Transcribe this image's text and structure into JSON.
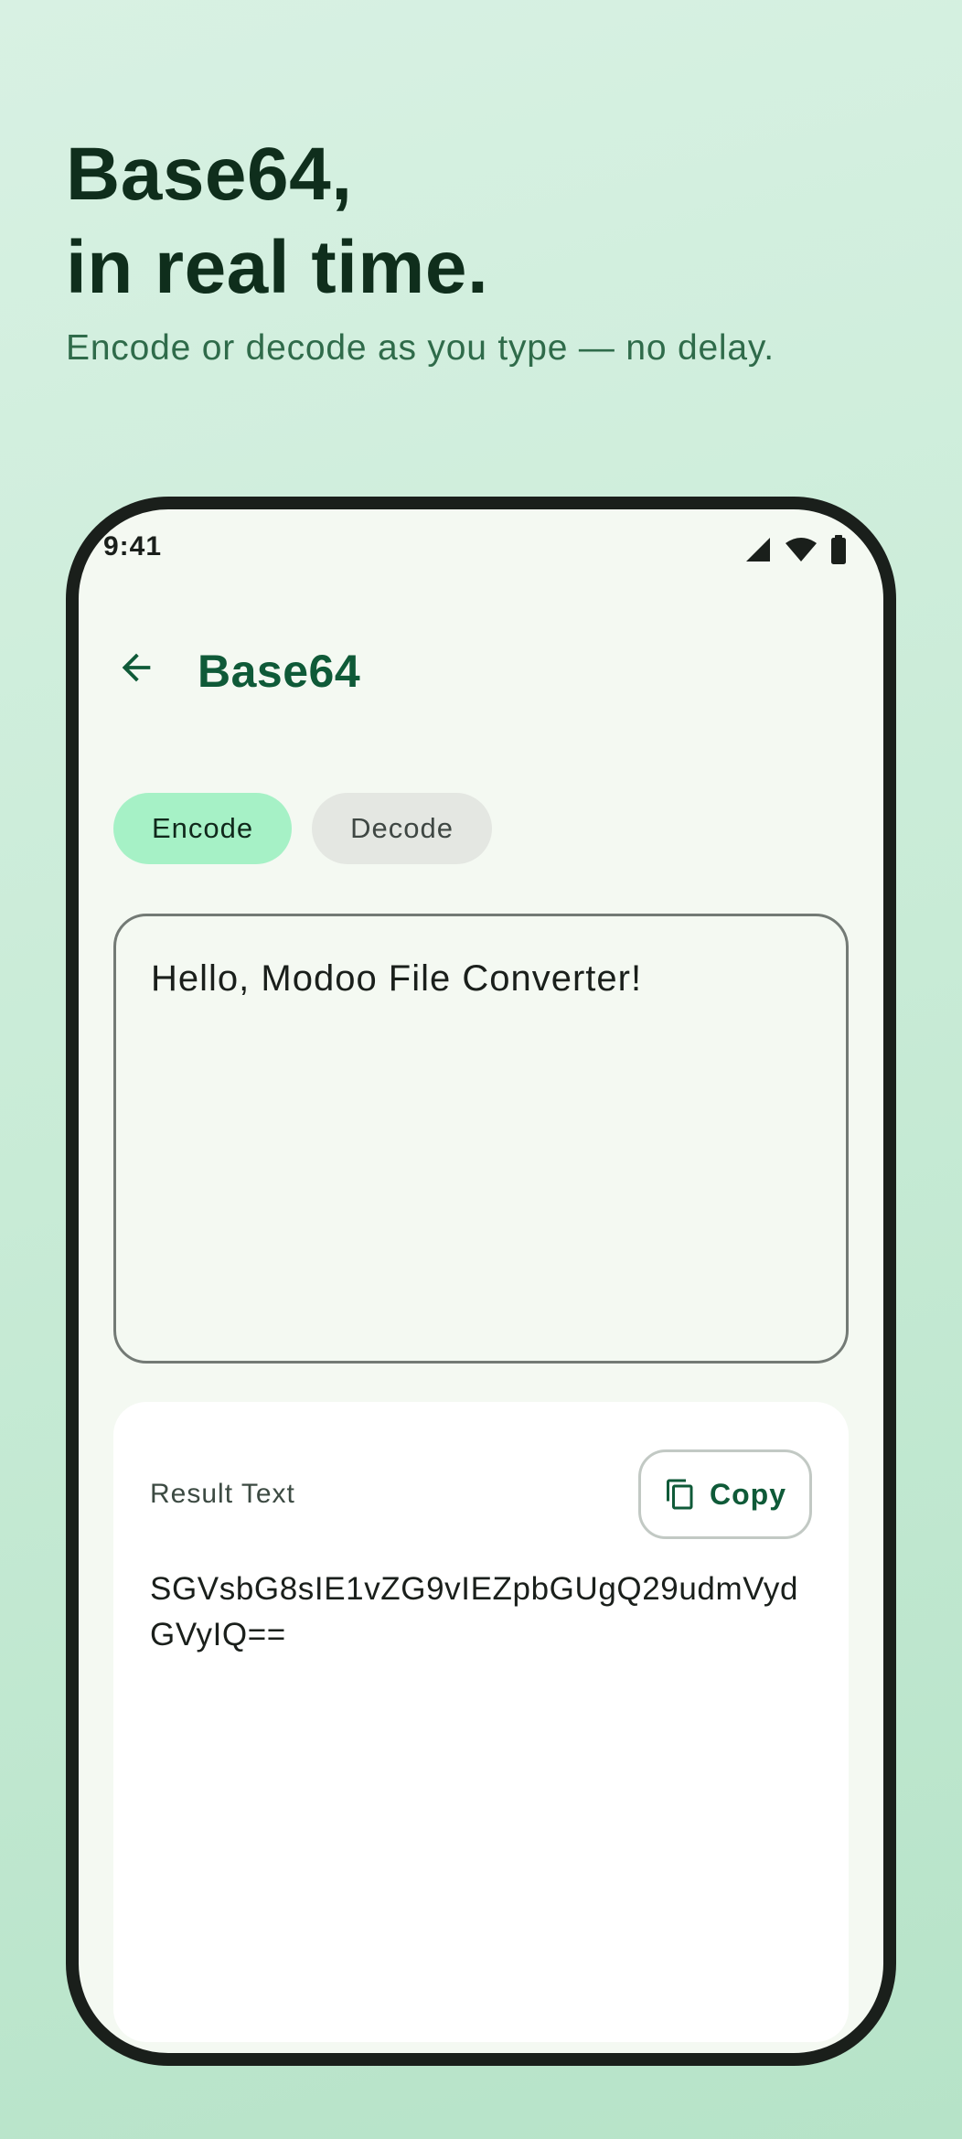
{
  "hero": {
    "title_line1": "Base64,",
    "title_line2": "in real time.",
    "subtitle": "Encode or decode as you type — no delay."
  },
  "status_bar": {
    "time": "9:41",
    "icons": [
      "signal-icon",
      "wifi-icon",
      "battery-icon"
    ]
  },
  "app_bar": {
    "back_icon": "arrow-back-icon",
    "title": "Base64"
  },
  "mode_chips": [
    {
      "label": "Encode",
      "selected": true
    },
    {
      "label": "Decode",
      "selected": false
    }
  ],
  "input": {
    "value": "Hello, Modoo File Converter!"
  },
  "result": {
    "label": "Result Text",
    "copy_label": "Copy",
    "copy_icon": "copy-icon",
    "text": "SGVsbG8sIE1vZG9vIEZpbGUgQ29udmVydGVyIQ=="
  },
  "colors": {
    "accent": "#0f5a38",
    "chip_selected": "#a6f1c6",
    "chip_unselected": "#e4e7e2",
    "phone_frame": "#1a1f1b",
    "background_top": "#d8f1e3",
    "background_bottom": "#b6e3c8"
  }
}
